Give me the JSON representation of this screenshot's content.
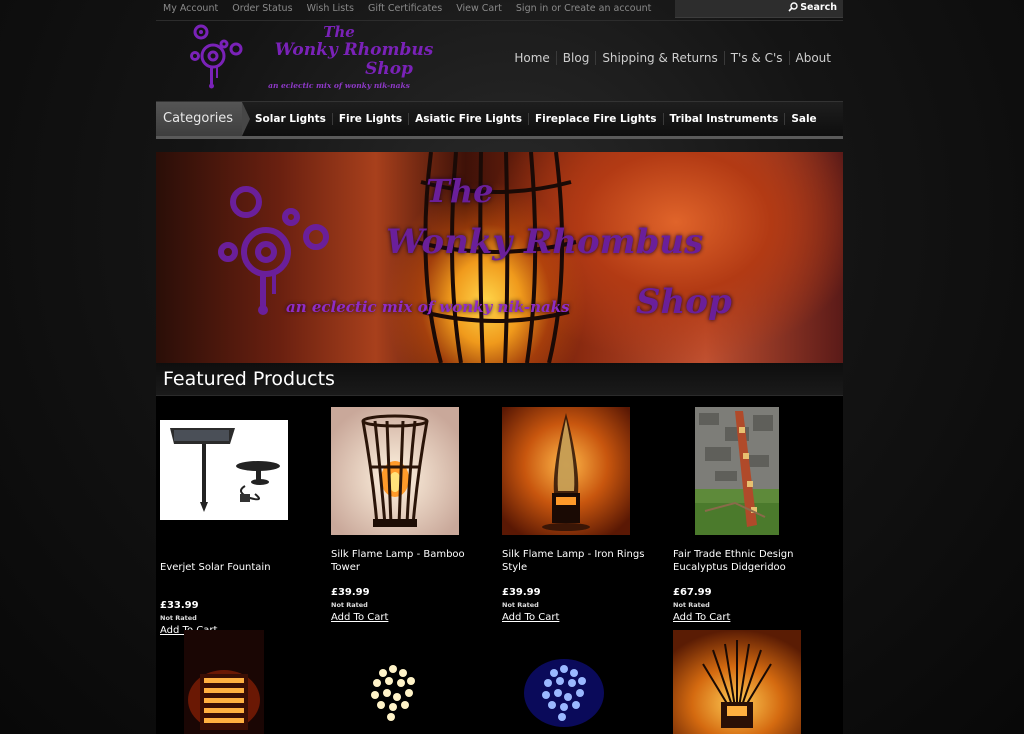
{
  "topbar": {
    "links": [
      "My Account",
      "Order Status",
      "Wish Lists",
      "Gift Certificates",
      "View Cart",
      "Sign in or Create an account"
    ],
    "search_placeholder": "",
    "search_label": "Search"
  },
  "logo": {
    "line1": "The",
    "line2": "Wonky Rhombus",
    "line3": "Shop",
    "tagline": "an eclectic mix of wonky nik-naks"
  },
  "mainnav": [
    "Home",
    "Blog",
    "Shipping & Returns",
    "T's & C's",
    "About"
  ],
  "categories": {
    "heading": "Categories",
    "items": [
      "Solar Lights",
      "Fire Lights",
      "Asiatic Fire Lights",
      "Fireplace Fire Lights",
      "Tribal Instruments",
      "Sale"
    ]
  },
  "banner": {
    "line1": "The",
    "line2": "Wonky Rhombus",
    "line3": "Shop",
    "tagline": "an eclectic mix of wonky nik-naks"
  },
  "featured": {
    "title": "Featured Products",
    "products": [
      {
        "name": "Everjet Solar Fountain",
        "price": "£33.99",
        "rating": "Not Rated",
        "cart": "Add To Cart"
      },
      {
        "name": "Silk Flame Lamp - Bamboo Tower",
        "price": "£39.99",
        "rating": "Not Rated",
        "cart": "Add To Cart"
      },
      {
        "name": "Silk Flame Lamp - Iron Rings Style",
        "price": "£39.99",
        "rating": "Not Rated",
        "cart": "Add To Cart"
      },
      {
        "name": "Fair Trade Ethnic Design Eucalyptus Didgeridoo",
        "price": "£67.99",
        "rating": "Not Rated",
        "cart": "Add To Cart"
      }
    ]
  },
  "colors": {
    "brand_purple": "#7a22b8",
    "background": "#0d0d0d"
  }
}
